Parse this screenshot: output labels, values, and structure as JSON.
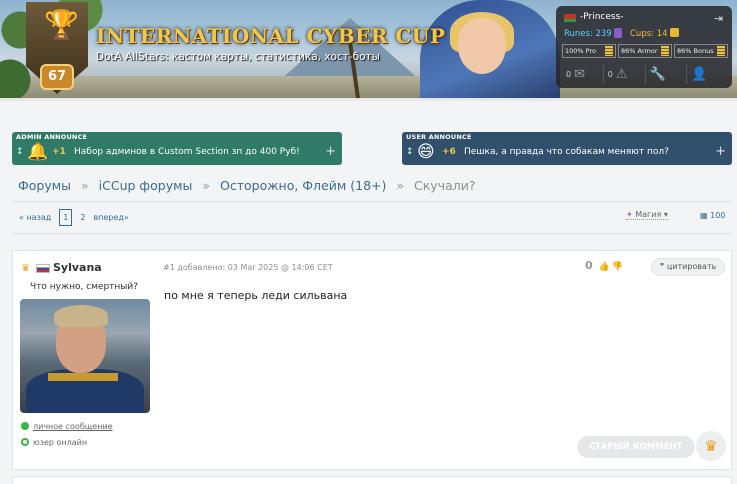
{
  "header": {
    "site_title": "INTERNATIONAL CYBER CUP",
    "site_subtitle": "DotA AllStars: кастом карты, статистика, хост-боты",
    "level": "67"
  },
  "profile": {
    "username": "-Princess-",
    "runes_label": "Runes: 239",
    "cups_label": "Cups: 14",
    "stats": [
      "100% Pro",
      "86% Armor",
      "86% Bonus"
    ],
    "messages_count": "0",
    "warnings_count": "0"
  },
  "announces": {
    "admin": {
      "tag": "ADMIN ANNOUNCE",
      "points": "+1",
      "text": "Набор админов в Custom Section зп до 400 Руб!",
      "plus": "+"
    },
    "user": {
      "tag": "USER ANNOUNCE",
      "points": "+6",
      "text": "Пешка, а правда что собакам меняют пол?",
      "plus": "+"
    }
  },
  "breadcrumb": {
    "items": [
      "Форумы",
      "iCCup форумы",
      "Осторожно, Флейм (18+)"
    ],
    "current": "Скучали?",
    "separator": "»"
  },
  "pager": {
    "prev": "« назад",
    "current_page": "1",
    "next_page": "2",
    "next": "вперед»",
    "sort_label": "Магия",
    "per_page": "100"
  },
  "post": {
    "author": "Sylvana",
    "user_status": "Что нужно, смертный?",
    "meta": "#1 добавлено: 03 Mar 2025 @ 14:06 CET",
    "rating": "0",
    "quote_label": "цитировать",
    "body": "по мне я теперь леди сильвана",
    "pm_label": "личное сообщение",
    "online_label": "юзер онлайн",
    "old_comment_label": "СТАРЫЙ КОММЕНТ"
  },
  "colors": {
    "admin_announce": "#2f7b67",
    "user_announce": "#31506b",
    "link": "#3c6b92",
    "gold": "#f1c84a"
  }
}
